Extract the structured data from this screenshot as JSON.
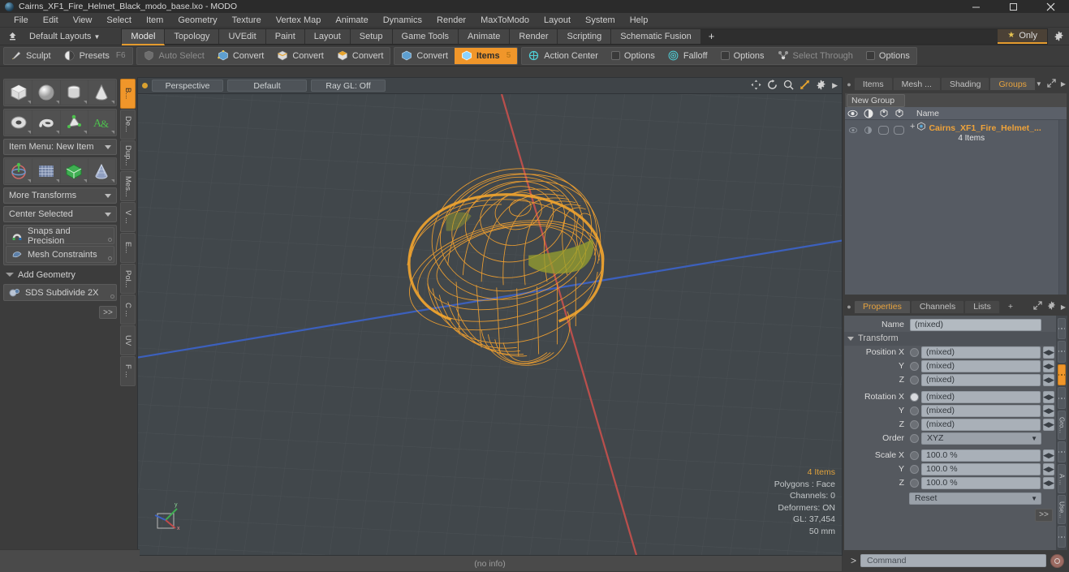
{
  "window": {
    "title": "Cairns_XF1_Fire_Helmet_Black_modo_base.lxo - MODO",
    "app_icon": "modo-sphere-icon",
    "minimize": "minimize-icon",
    "maximize": "maximize-icon",
    "close": "close-icon"
  },
  "menubar": {
    "items": [
      "File",
      "Edit",
      "View",
      "Select",
      "Item",
      "Geometry",
      "Texture",
      "Vertex Map",
      "Animate",
      "Dynamics",
      "Render",
      "MaxToModo",
      "Layout",
      "System",
      "Help"
    ]
  },
  "layoutbar": {
    "home_icon": "home-layout-icon",
    "layouts_label": "Default Layouts",
    "tabs": [
      "Model",
      "Topology",
      "UVEdit",
      "Paint",
      "Layout",
      "Setup",
      "Game Tools",
      "Animate",
      "Render",
      "Scripting",
      "Schematic Fusion"
    ],
    "active_tab": "Model",
    "add_tab": "+",
    "only_label": "Only",
    "only_star": "star-icon",
    "settings_icon": "gear-icon"
  },
  "toolbar": {
    "group1": [
      {
        "label": "Sculpt",
        "icon": "sculpt-brush-icon",
        "shortcut": ""
      },
      {
        "label": "Presets",
        "icon": "presets-sphere-icon",
        "shortcut": "F6"
      }
    ],
    "group2": [
      {
        "label": "Auto Select",
        "icon": "auto-select-icon",
        "dim": true
      },
      {
        "label": "Convert",
        "icon": "vertices-cube-icon"
      },
      {
        "label": "Convert",
        "icon": "edges-cube-icon"
      },
      {
        "label": "Convert",
        "icon": "polygons-cube-icon"
      }
    ],
    "group3": [
      {
        "label": "Convert",
        "icon": "materials-cube-icon"
      },
      {
        "label": "Items",
        "icon": "items-cube-icon",
        "active": true,
        "badge": "5"
      }
    ],
    "group4": [
      {
        "label": "Action Center",
        "icon": "action-center-icon"
      },
      {
        "label": "Options",
        "icon": "checkbox-icon"
      },
      {
        "label": "Falloff",
        "icon": "falloff-icon"
      },
      {
        "label": "Options",
        "icon": "checkbox-icon"
      },
      {
        "label": "Select Through",
        "icon": "select-through-icon",
        "dim": true
      },
      {
        "label": "Options",
        "icon": "checkbox-icon"
      }
    ]
  },
  "left_panel": {
    "primitives_row1": [
      "cube-icon",
      "sphere-icon",
      "cylinder-icon",
      "cone-icon"
    ],
    "primitives_row2": [
      "torus-icon",
      "spiral-icon",
      "bezier-pen-icon",
      "text-tool-icon"
    ],
    "item_menu": "Item Menu: New Item",
    "tools_row": [
      "transform-axis-icon",
      "grid-mesh-icon",
      "green-poly-icon",
      "cone-mesh-icon"
    ],
    "more_transforms": "More Transforms",
    "center_selected": "Center Selected",
    "snaps": {
      "label": "Snaps and Precision",
      "icon": "snap-magnet-icon"
    },
    "mesh_constraints": {
      "label": "Mesh Constraints",
      "icon": "mesh-constraint-icon"
    },
    "add_geometry": "Add Geometry",
    "sds_subdivide": {
      "label": "SDS Subdivide 2X",
      "icon": "sds-icon"
    },
    "more_button": ">>",
    "vtabs": [
      "B...",
      "De...",
      "Dup...",
      "Mes...",
      "V ...",
      "E...",
      "Pol...",
      "C ...",
      "UV",
      "F ..."
    ],
    "vtab_active": "B..."
  },
  "viewport": {
    "dot_icon": "viewport-menu-dot-icon",
    "projection": "Perspective",
    "shading": "Default",
    "raygl": "Ray GL: Off",
    "icons": [
      "pan-icon",
      "rotate-icon",
      "zoom-icon",
      "fit-icon",
      "viewport-gear-icon",
      "viewport-arrow-icon"
    ],
    "gizmo": "axis-gizmo",
    "info": {
      "items": "4 Items",
      "polygons": "Polygons : Face",
      "channels": "Channels: 0",
      "deformers": "Deformers: ON",
      "gl": "GL: 37,454",
      "scale": "50 mm"
    },
    "footer": "(no info)",
    "colors": {
      "background": "#41474b",
      "wireframe": "#f0a030",
      "axis_x": "#c0504d",
      "axis_z": "#4a6fd0"
    }
  },
  "items_panel": {
    "tabs": [
      "Items",
      "Mesh ...",
      "Shading",
      "Groups"
    ],
    "active_tab": "Groups",
    "dropdown_icon": "chevron-down-icon",
    "expand_icon": "expand-panel-icon",
    "arrow_icon": "panel-arrow-icon",
    "new_group_label": "New Group",
    "columns": [
      "eye-visibility-icon",
      "render-icon",
      "lock-icon",
      "select-icon",
      "Name"
    ],
    "rows": [
      {
        "name": "Cairns_XF1_Fire_Helmet_...",
        "sub": "4 Items",
        "icon": "group-item-icon"
      }
    ]
  },
  "properties_panel": {
    "tabs": [
      "Properties",
      "Channels",
      "Lists",
      "+"
    ],
    "active_tab": "Properties",
    "gear_icon": "gear-icon",
    "expand_icon": "expand-panel-icon",
    "arrow_icon": "panel-arrow-icon",
    "name_label": "Name",
    "name_value": "(mixed)",
    "transform_section": "Transform",
    "fields": [
      {
        "label": "Position X",
        "value": "(mixed)",
        "radio": false
      },
      {
        "label": "Y",
        "value": "(mixed)",
        "radio": false
      },
      {
        "label": "Z",
        "value": "(mixed)",
        "radio": false
      },
      {
        "label": "Rotation X",
        "value": "(mixed)",
        "radio": true
      },
      {
        "label": "Y",
        "value": "(mixed)",
        "radio": false
      },
      {
        "label": "Z",
        "value": "(mixed)",
        "radio": false
      }
    ],
    "order_label": "Order",
    "order_value": "XYZ",
    "scale_fields": [
      {
        "label": "Scale X",
        "value": "100.0 %"
      },
      {
        "label": "Y",
        "value": "100.0 %"
      },
      {
        "label": "Z",
        "value": "100.0 %"
      }
    ],
    "reset_label": "Reset",
    "more_button": ">>",
    "vtabs": [
      "Gro...",
      "A ...",
      "Use..."
    ]
  },
  "command_bar": {
    "prompt": ">",
    "placeholder": "Command",
    "record_icon": "record-icon"
  }
}
